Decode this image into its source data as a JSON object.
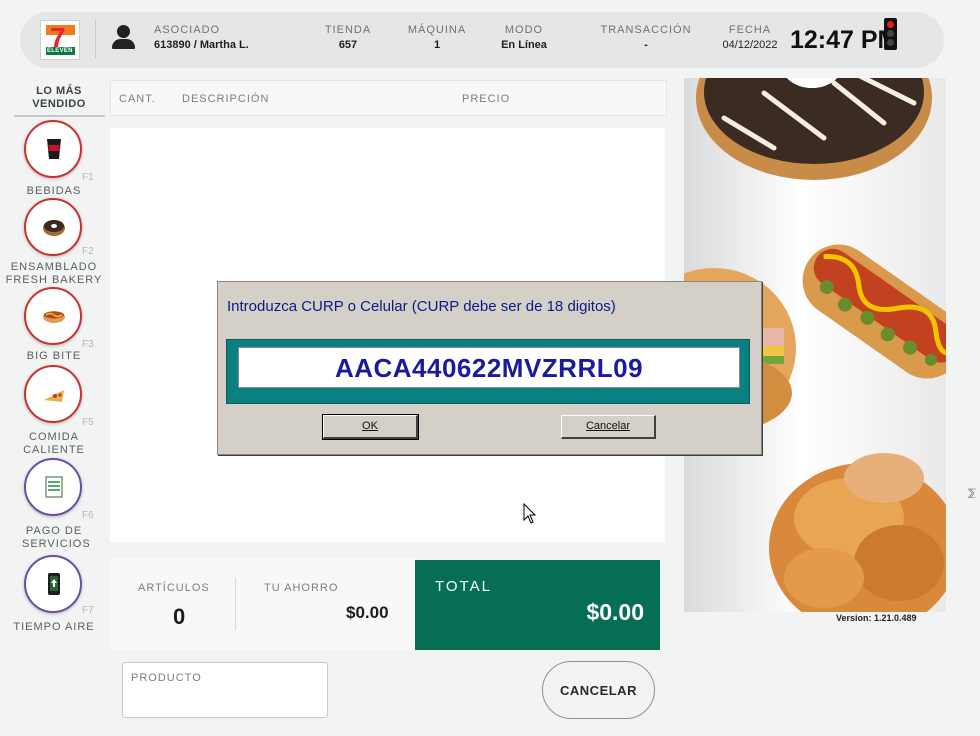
{
  "header": {
    "associate": {
      "label": "ASOCIADO",
      "value": "613890 / Martha L."
    },
    "store": {
      "label": "TIENDA",
      "value": "657"
    },
    "machine": {
      "label": "MÁQUINA",
      "value": "1"
    },
    "mode": {
      "label": "MODO",
      "value": "En Línea"
    },
    "transaction": {
      "label": "TRANSACCIÓN",
      "value": "-"
    },
    "date": {
      "label": "FECHA",
      "value": "04/12/2022"
    },
    "time": "12:47 PM",
    "logo_text": "7 ELEVEN",
    "status_light": "red"
  },
  "sidebar": {
    "title_line1": "LO MÁS",
    "title_line2": "VENDIDO",
    "categories": [
      {
        "name": "BEBIDAS",
        "fkey": "F1",
        "icon": "cup-icon"
      },
      {
        "name": "ENSAMBLADO FRESH BAKERY",
        "fkey": "F2",
        "icon": "donut-icon"
      },
      {
        "name": "BIG BITE",
        "fkey": "F3",
        "icon": "hotdog-icon"
      },
      {
        "name": "COMIDA CALIENTE",
        "fkey": "F5",
        "icon": "pizza-icon"
      },
      {
        "name": "PAGO DE SERVICIOS",
        "fkey": "F6",
        "icon": "receipt-icon"
      },
      {
        "name": "TIEMPO AIRE",
        "fkey": "F7",
        "icon": "phone-icon"
      }
    ]
  },
  "list": {
    "columns": {
      "qty": "CANT.",
      "desc": "DESCRIPCIÓN",
      "price": "PRECIO"
    },
    "rows": []
  },
  "totals": {
    "items_label": "ARTÍCULOS",
    "items_value": "0",
    "savings_label": "TU AHORRO",
    "savings_value": "$0.00",
    "total_label": "TOTAL",
    "total_value": "$0.00"
  },
  "bottom": {
    "product_label": "PRODUCTO",
    "cancel_label": "CANCELAR"
  },
  "version": "Version: 1.21.0.489",
  "dialog": {
    "prompt": "Introduzca CURP o Celular (CURP debe ser de 18 digitos)",
    "value": "AACA440622MVZRRL09",
    "ok_label": "OK",
    "cancel_label": "Cancelar"
  },
  "colors": {
    "accent_green": "#066e55",
    "category_red": "#c6342f",
    "category_violet": "#6a4fa3",
    "dialog_bg": "#d4d0c8",
    "dialog_frame": "#0b8080",
    "dialog_text": "#1a1aa0"
  }
}
